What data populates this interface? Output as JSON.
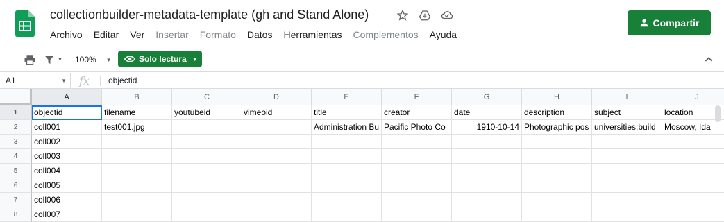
{
  "app": {
    "title": "collectionbuilder-metadata-template (gh and Stand Alone)",
    "brand_color": "#188038",
    "icons": [
      "sheets-logo-icon",
      "star-icon",
      "move-to-drive-icon",
      "cloud-saved-icon"
    ]
  },
  "menu": [
    {
      "label": "Archivo",
      "enabled": true
    },
    {
      "label": "Editar",
      "enabled": true
    },
    {
      "label": "Ver",
      "enabled": true
    },
    {
      "label": "Insertar",
      "enabled": false
    },
    {
      "label": "Formato",
      "enabled": false
    },
    {
      "label": "Datos",
      "enabled": true
    },
    {
      "label": "Herramientas",
      "enabled": true
    },
    {
      "label": "Complementos",
      "enabled": false
    },
    {
      "label": "Ayuda",
      "enabled": true
    }
  ],
  "share_label": "Compartir",
  "toolbar": {
    "zoom": "100%",
    "mode_label": "Solo lectura"
  },
  "formula": {
    "cell_ref": "A1",
    "fx": "fx",
    "value": "objectid"
  },
  "sheet": {
    "columns": [
      "A",
      "B",
      "C",
      "D",
      "E",
      "F",
      "G",
      "H",
      "I",
      "J"
    ],
    "row_numbers": [
      "1",
      "2",
      "3",
      "4",
      "5",
      "6",
      "7",
      "8"
    ],
    "rows": [
      [
        "objectid",
        "filename",
        "youtubeid",
        "vimeoid",
        "title",
        "creator",
        "date",
        "description",
        "subject",
        "location"
      ],
      [
        "coll001",
        "test001.jpg",
        "",
        "",
        "Administration Bu",
        "Pacific Photo Co",
        "1910-10-14",
        "Photographic pos",
        "universities;build",
        "Moscow, Ida"
      ],
      [
        "coll002",
        "",
        "",
        "",
        "",
        "",
        "",
        "",
        "",
        ""
      ],
      [
        "coll003",
        "",
        "",
        "",
        "",
        "",
        "",
        "",
        "",
        ""
      ],
      [
        "coll004",
        "",
        "",
        "",
        "",
        "",
        "",
        "",
        "",
        ""
      ],
      [
        "coll005",
        "",
        "",
        "",
        "",
        "",
        "",
        "",
        "",
        ""
      ],
      [
        "coll006",
        "",
        "",
        "",
        "",
        "",
        "",
        "",
        "",
        ""
      ],
      [
        "coll007",
        "",
        "",
        "",
        "",
        "",
        "",
        "",
        "",
        ""
      ]
    ]
  }
}
